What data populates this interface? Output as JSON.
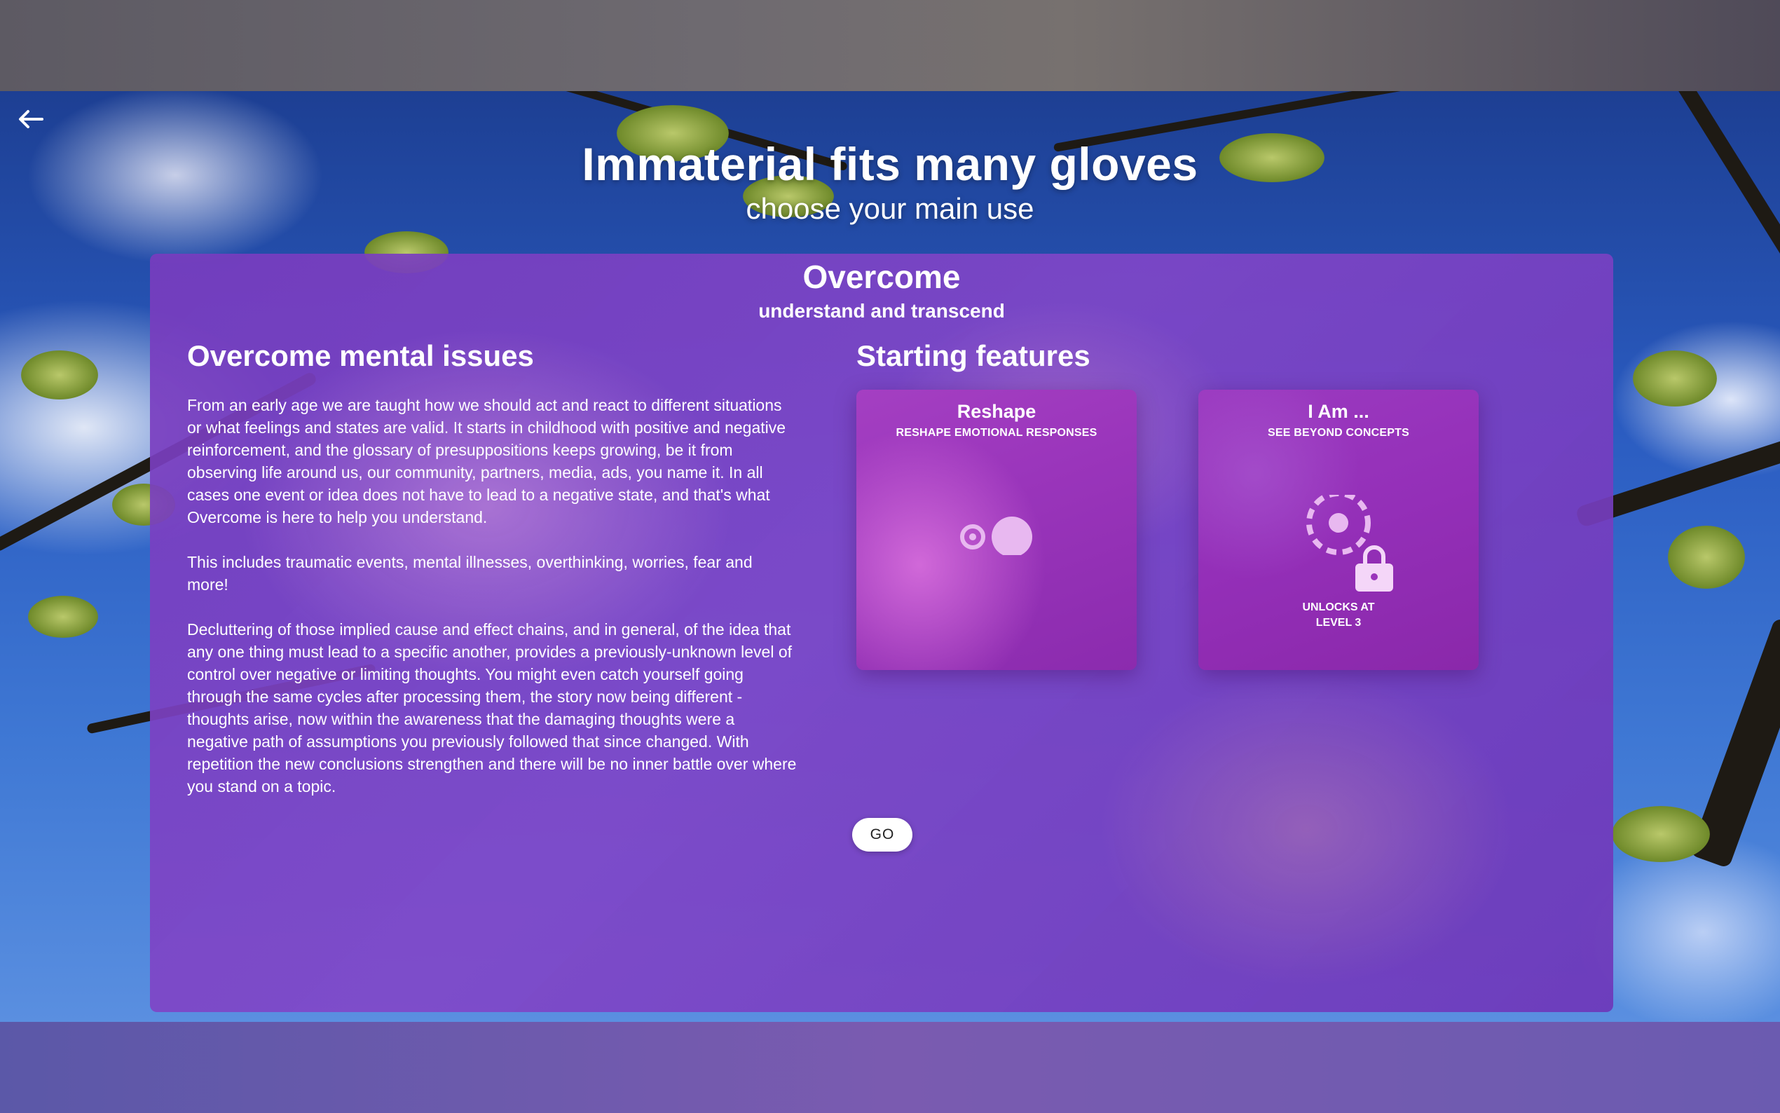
{
  "header": {
    "title": "Immaterial fits many gloves",
    "subtitle": "choose your main use"
  },
  "nav": {
    "back_icon": "arrow-left-icon"
  },
  "panel": {
    "title": "Overcome",
    "subtitle": "understand and transcend",
    "left": {
      "heading": "Overcome mental issues",
      "paragraphs": [
        "From an early age we are taught how we should act and react to different situations or what feelings and states are valid. It starts in childhood with positive and negative reinforcement, and the glossary of presuppositions keeps growing, be it from observing life around us, our community, partners, media, ads, you name it. In all cases one event or idea does not have to lead to a negative state, and that's what Overcome is here to help you understand.",
        "This includes traumatic events, mental illnesses, overthinking, worries, fear and more!",
        "Decluttering of those implied cause and effect chains, and in general, of the idea that any one thing must lead to a specific another, provides a previously-unknown level of control over negative or limiting thoughts. You might even catch yourself going through the same cycles after processing them, the story now being different - thoughts arise, now within the awareness that the damaging thoughts were a negative path of assumptions you previously followed that since changed. With repetition the new conclusions strengthen and there will be no inner battle over where you stand on a topic."
      ]
    },
    "right": {
      "heading": "Starting features",
      "cards": [
        {
          "title": "Reshape",
          "tagline": "RESHAPE EMOTIONAL RESPONSES",
          "icon": "reshape-dots-icon",
          "locked": false
        },
        {
          "title": "I Am ...",
          "tagline": "SEE BEYOND CONCEPTS",
          "icon": "dashed-circle-icon",
          "locked": true,
          "lock_icon": "lock-icon",
          "lock_label_line1": "UNLOCKS AT",
          "lock_label_line2": "LEVEL 3"
        }
      ]
    },
    "go_label": "GO"
  },
  "colors": {
    "panel_purple": "#7a3fc0",
    "card_magenta": "#9a35bb",
    "text": "#ffffff",
    "button_bg": "#ffffff",
    "button_text": "#222222"
  }
}
